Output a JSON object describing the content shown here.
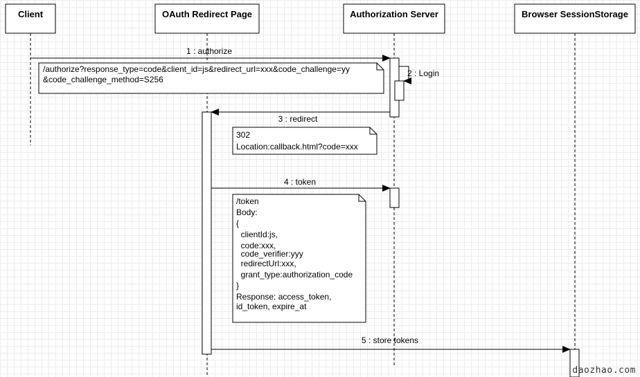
{
  "participants": [
    {
      "id": "client",
      "label": "Client"
    },
    {
      "id": "redirect",
      "label": "OAuth Redirect Page"
    },
    {
      "id": "authserver",
      "label": "Authorization Server"
    },
    {
      "id": "storage",
      "label": "Browser SessionStorage"
    }
  ],
  "messages": [
    {
      "label": "1 : authorize"
    },
    {
      "label": "2 : Login"
    },
    {
      "label": "3 : redirect"
    },
    {
      "label": "4 : token"
    },
    {
      "label": "5 : store tokens"
    }
  ],
  "notes": [
    {
      "lines": [
        "/authorize?response_type=code&client_id=js&redirect_url=xxx&code_challenge=yy",
        "&code_challenge_method=S256"
      ]
    },
    {
      "lines": [
        "302",
        "Location:callback.html?code=xxx"
      ]
    },
    {
      "lines": [
        "/token",
        "Body:",
        "{",
        "  clientId:js,",
        "  code:xxx,",
        "  code_verifier:yyy",
        "  redirectUrl:xxx,",
        "  grant_type:authorization_code",
        "}",
        "Response: access_token,",
        "id_token, expire_at"
      ]
    }
  ],
  "watermark": "daozhao.com"
}
